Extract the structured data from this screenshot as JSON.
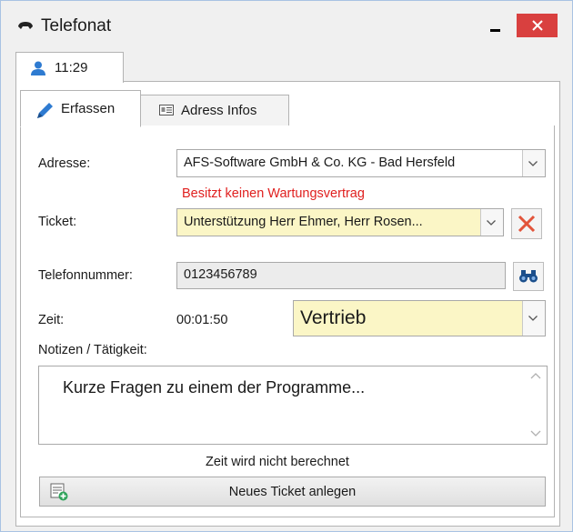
{
  "window": {
    "title": "Telefonat",
    "phone_icon": "phone-icon",
    "minimize_icon": "minimize-icon",
    "close_icon": "close-icon",
    "close_color": "#d9403f"
  },
  "outer_tab": {
    "label": "11:29",
    "icon": "person-icon",
    "icon_color": "#2e7bd1"
  },
  "tabs": [
    {
      "label": "Erfassen",
      "icon": "pencil-icon",
      "active": true
    },
    {
      "label": "Adress Infos",
      "icon": "address-card-icon",
      "active": false
    }
  ],
  "form": {
    "address_label": "Adresse:",
    "address_value": "AFS-Software GmbH & Co. KG - Bad Hersfeld",
    "warning_text": "Besitzt keinen Wartungsvertrag",
    "warning_color": "#e0201f",
    "ticket_label": "Ticket:",
    "ticket_value": "Unterstützung Herr Ehmer, Herr Rosen...",
    "phone_label": "Telefonnummer:",
    "phone_value": "0123456789",
    "time_label": "Zeit:",
    "time_value": "00:01:50",
    "category_value": "Vertrieb",
    "notes_label": "Notizen / Tätigkeit:",
    "notes_value": "Kurze Fragen zu einem der Programme...",
    "field_highlight_color": "#fbf6c6"
  },
  "footer": {
    "calc_note": "Zeit wird nicht berechnet",
    "new_ticket_label": "Neues Ticket anlegen",
    "new_ticket_icon": "new-ticket-icon"
  }
}
